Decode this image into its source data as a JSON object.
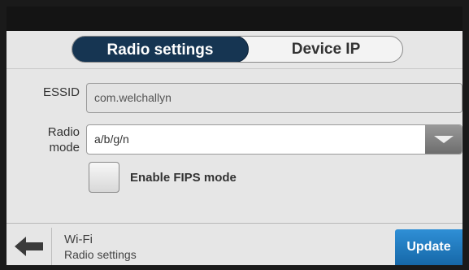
{
  "tabs": [
    {
      "label": "Radio settings",
      "active": true
    },
    {
      "label": "Device IP",
      "active": false
    }
  ],
  "form": {
    "essid_label": "ESSID",
    "essid_value": "com.welchallyn",
    "radio_mode_label_line1": "Radio",
    "radio_mode_label_line2": "mode",
    "radio_mode_value": "a/b/g/n",
    "fips_label": "Enable FIPS mode",
    "fips_checked": false
  },
  "footer": {
    "breadcrumb_title": "Wi-Fi",
    "breadcrumb_subtitle": "Radio settings",
    "back_icon": "left-arrow-icon",
    "update_label": "Update"
  },
  "colors": {
    "active_tab": "#163552",
    "update_button": "#1f78be",
    "background": "#e6e6e6"
  }
}
